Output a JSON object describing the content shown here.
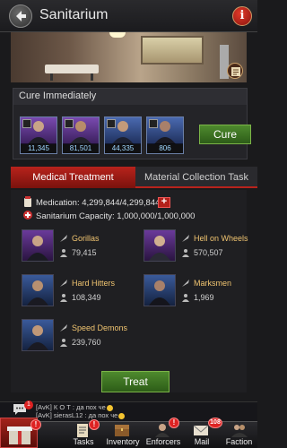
{
  "header": {
    "title": "Sanitarium"
  },
  "cure": {
    "label": "Cure Immediately",
    "button": "Cure",
    "units": [
      {
        "count": "11,345",
        "color": "#5b2f8a"
      },
      {
        "count": "81,501",
        "color": "#5b2f8a"
      },
      {
        "count": "44,335",
        "color": "#2f4f8a"
      },
      {
        "count": "806",
        "color": "#2f4f8a"
      }
    ]
  },
  "tabs": {
    "active": "Medical Treatment",
    "inactive": "Material Collection Task"
  },
  "stats": {
    "medication": "Medication: 4,299,844/4,299,844",
    "capacity": "Sanitarium Capacity: 1,000,000/1,000,000"
  },
  "troops": [
    {
      "name": "Gorillas",
      "value": "79,415"
    },
    {
      "name": "Hell on Wheels",
      "value": "570,507"
    },
    {
      "name": "Hard Hitters",
      "value": "108,349"
    },
    {
      "name": "Marksmen",
      "value": "1,969"
    },
    {
      "name": "Speed Demons",
      "value": "239,760"
    }
  ],
  "treat_button": "Treat",
  "chat": {
    "notif": "1",
    "line1": "[AvK] К О Т : да пох че",
    "line2": "[AvK] sierasL12 : да пох че"
  },
  "nav": {
    "tasks": "Tasks",
    "inventory": "Inventory",
    "enforcers": "Enforcers",
    "mail": "Mail",
    "mail_badge": "108",
    "faction": "Faction",
    "alert": "!"
  },
  "colors": {
    "accent_red": "#b8231c",
    "button_green": "#3f7a24",
    "troop_name": "#f0c470"
  }
}
